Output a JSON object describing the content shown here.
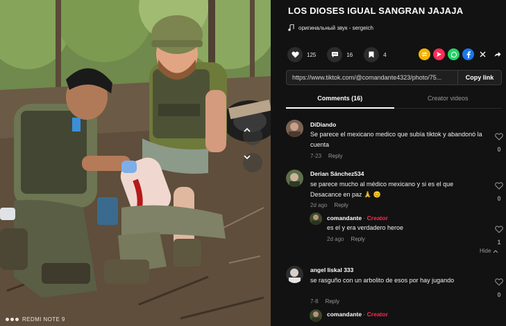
{
  "photo": {
    "watermark": "REDMI NOTE 9"
  },
  "post": {
    "title": "LOS DIOSES IGUAL SANGRAN JAJAJA",
    "sound": "оригинальный звук - sergeich",
    "likes": "125",
    "comments": "16",
    "saves": "4",
    "link_url": "https://www.tiktok.com/@comandante4323/photo/75...",
    "copy_label": "Copy link"
  },
  "share": {
    "icons": [
      "repost-icon",
      "send-icon",
      "whatsapp-icon",
      "facebook-icon",
      "x-icon",
      "share-arrow-icon"
    ],
    "colors": [
      "#f5b400",
      "#fe2c55",
      "#25d366",
      "#1877f2",
      "#121212",
      "#121212"
    ]
  },
  "tabs": [
    "Comments (16)",
    "Creator videos"
  ],
  "comments": [
    {
      "user": "DiDiando",
      "text": "Se parece el mexicano medico que subía tiktok y abandonó la cuenta",
      "date": "7-23",
      "reply": "Reply",
      "likes": "0"
    },
    {
      "user": "Derian Sánchez534",
      "text": "se parece mucho al médico mexicano y si es el que Desacance en paz 🙏 😊",
      "date": "2d ago",
      "reply": "Reply",
      "likes": "0"
    },
    {
      "user": "comandante",
      "creator_label": "Creator",
      "separator": " · ",
      "text": "es el y era verdadero heroe",
      "date": "2d ago",
      "reply": "Reply",
      "likes": "1"
    },
    {
      "user": "angel liskal 333",
      "text": "se rasguño con un arbolito de esos por hay jugando",
      "date": "7-8",
      "reply": "Reply",
      "likes": "0"
    },
    {
      "user": "comandante",
      "creator_label": "Creator",
      "separator": " · "
    }
  ],
  "hide_label": "Hide"
}
